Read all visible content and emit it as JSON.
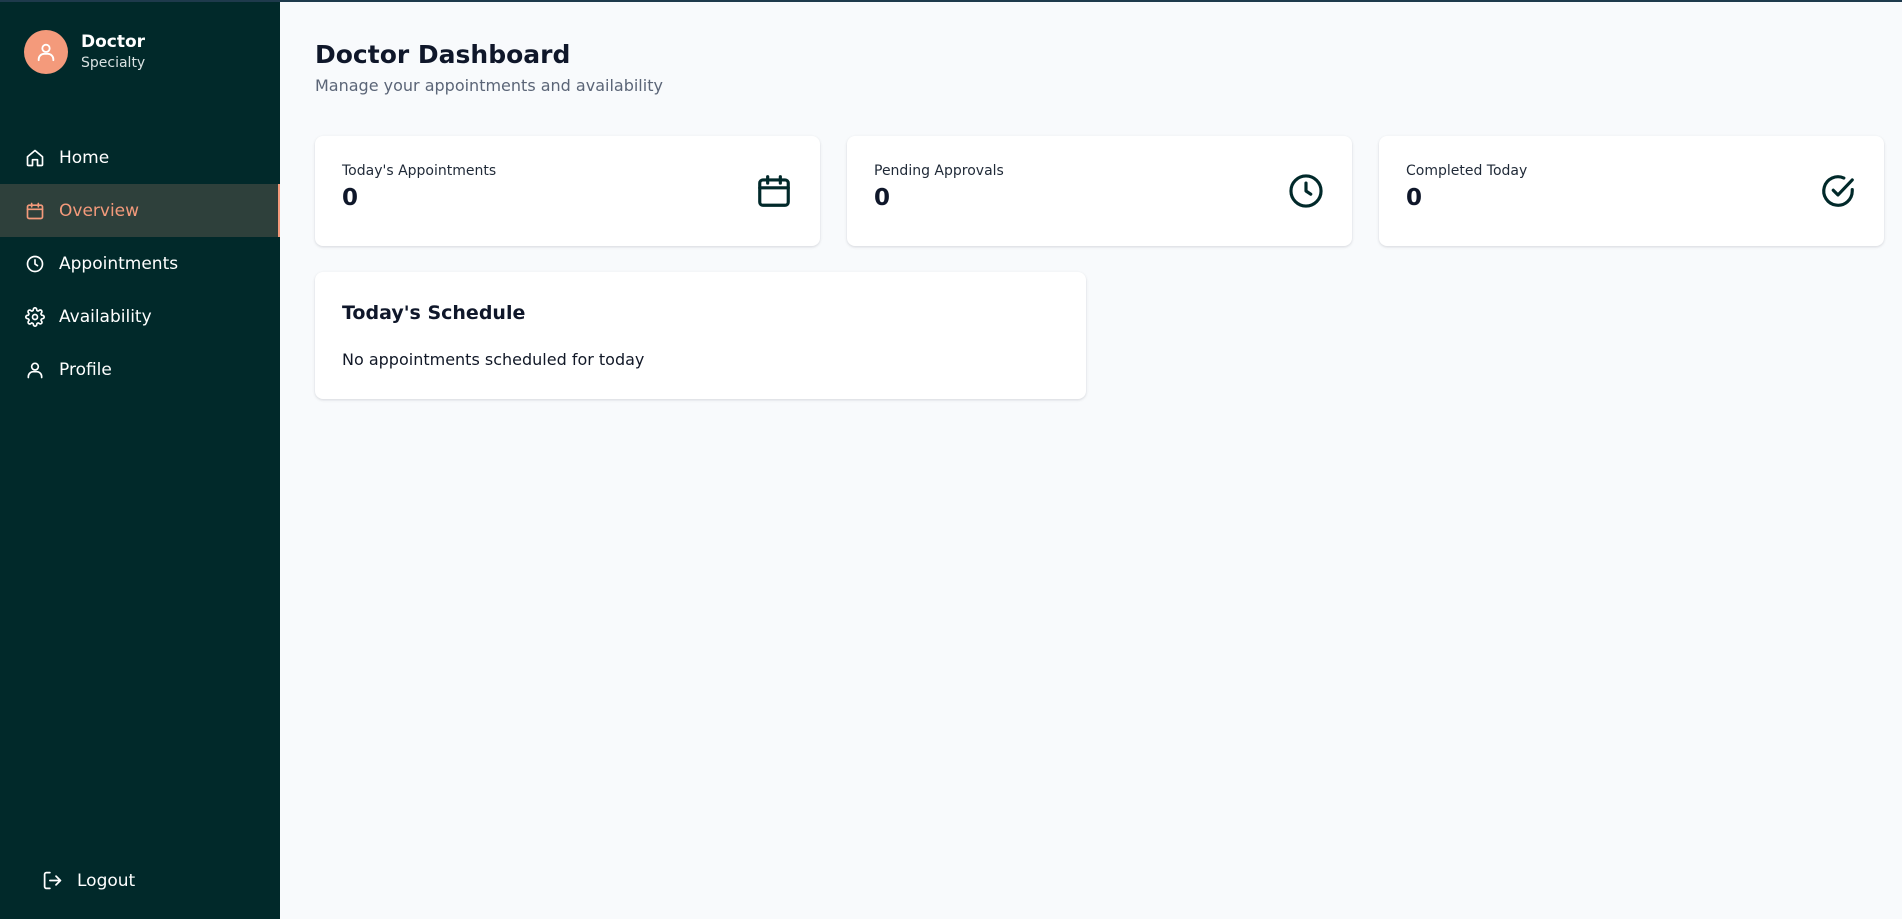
{
  "user": {
    "name": "Doctor",
    "specialty": "Specialty"
  },
  "sidebar": {
    "items": [
      {
        "label": "Home",
        "icon": "home-icon",
        "active": false
      },
      {
        "label": "Overview",
        "icon": "calendar-icon",
        "active": true
      },
      {
        "label": "Appointments",
        "icon": "clock-icon",
        "active": false
      },
      {
        "label": "Availability",
        "icon": "gear-icon",
        "active": false
      },
      {
        "label": "Profile",
        "icon": "user-icon",
        "active": false
      }
    ],
    "logout_label": "Logout"
  },
  "header": {
    "title": "Doctor Dashboard",
    "subtitle": "Manage your appointments and availability"
  },
  "stats": [
    {
      "label": "Today's Appointments",
      "value": "0",
      "icon": "calendar-icon"
    },
    {
      "label": "Pending Approvals",
      "value": "0",
      "icon": "clock-icon"
    },
    {
      "label": "Completed Today",
      "value": "0",
      "icon": "check-circle-icon"
    }
  ],
  "schedule": {
    "title": "Today's Schedule",
    "empty_message": "No appointments scheduled for today"
  },
  "colors": {
    "sidebar_bg": "#01292a",
    "accent": "#f49a7b",
    "active_bg": "#2e403b",
    "page_bg": "#f8fafc"
  }
}
